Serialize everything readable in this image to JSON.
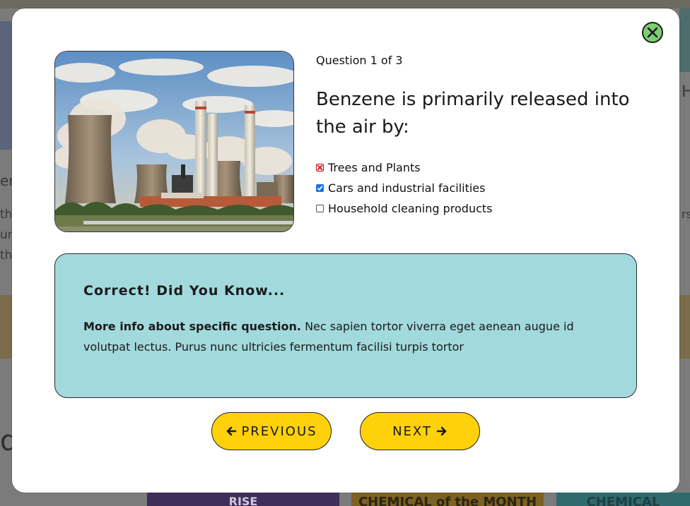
{
  "background": {
    "left_text": [
      "en",
      "th",
      "un",
      "th"
    ],
    "right_text": [
      "H",
      "rs"
    ],
    "bottom_left_text": "d",
    "bottom_banner_1": "RISE",
    "bottom_banner_2": "CHEMICAL of the MONTH",
    "bottom_banner_3": "CHEMICAL"
  },
  "modal": {
    "counter": "Question 1 of 3",
    "question": "Benzene is primarily released into the air by:",
    "image_alt": "Power plant with cooling towers and smokestacks",
    "options": [
      {
        "label": "Trees and Plants",
        "state": "wrong"
      },
      {
        "label": "Cars and industrial facilities",
        "state": "checked"
      },
      {
        "label": "Household cleaning products",
        "state": "unchecked"
      }
    ],
    "feedback": {
      "title": "Correct! Did You Know...",
      "bold": "More info about specific question.",
      "text": " Nec sapien tortor viverra eget aenean augue id volutpat lectus. Purus nunc ultricies fermentum facilisi turpis tortor"
    },
    "prev_label": "PREVIOUS",
    "next_label": "NEXT"
  },
  "colors": {
    "accent_button": "#ffd10a",
    "feedback_bg": "#a2d9dc",
    "close_button": "#7bd170",
    "wrong_mark": "#d01010",
    "checked": "#1a73e8"
  }
}
